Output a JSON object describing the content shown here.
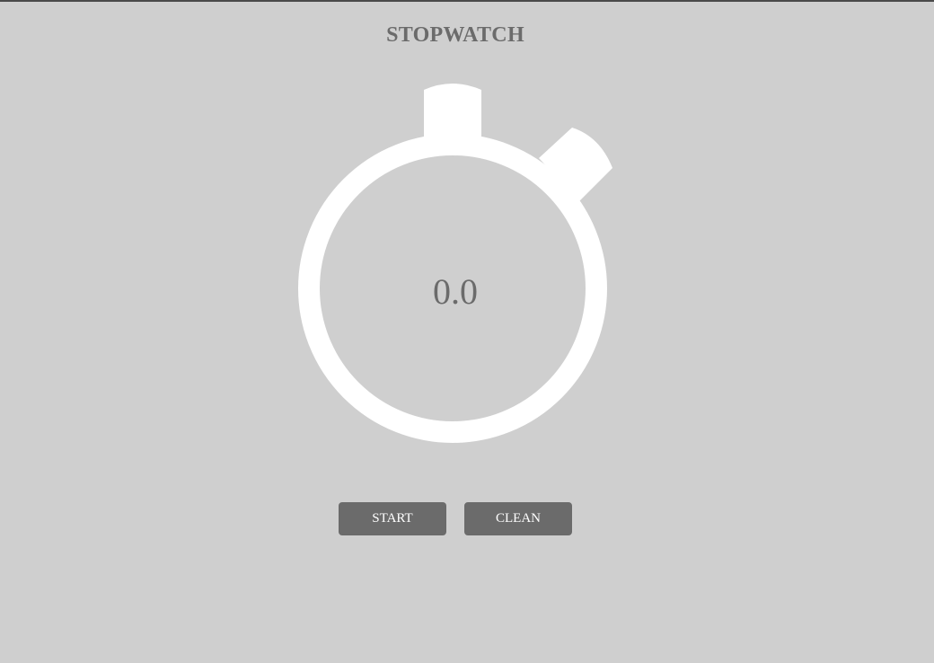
{
  "app": {
    "title": "STOPWATCH"
  },
  "stopwatch": {
    "time": "0.0"
  },
  "controls": {
    "start_label": "START",
    "clean_label": "CLEAN"
  },
  "colors": {
    "background": "#cfcfcf",
    "text": "#6b6b6b",
    "button": "#6b6b6b",
    "button_text": "#ffffff",
    "dial": "#ffffff"
  },
  "icons": {
    "stopwatch": "stopwatch-icon"
  }
}
